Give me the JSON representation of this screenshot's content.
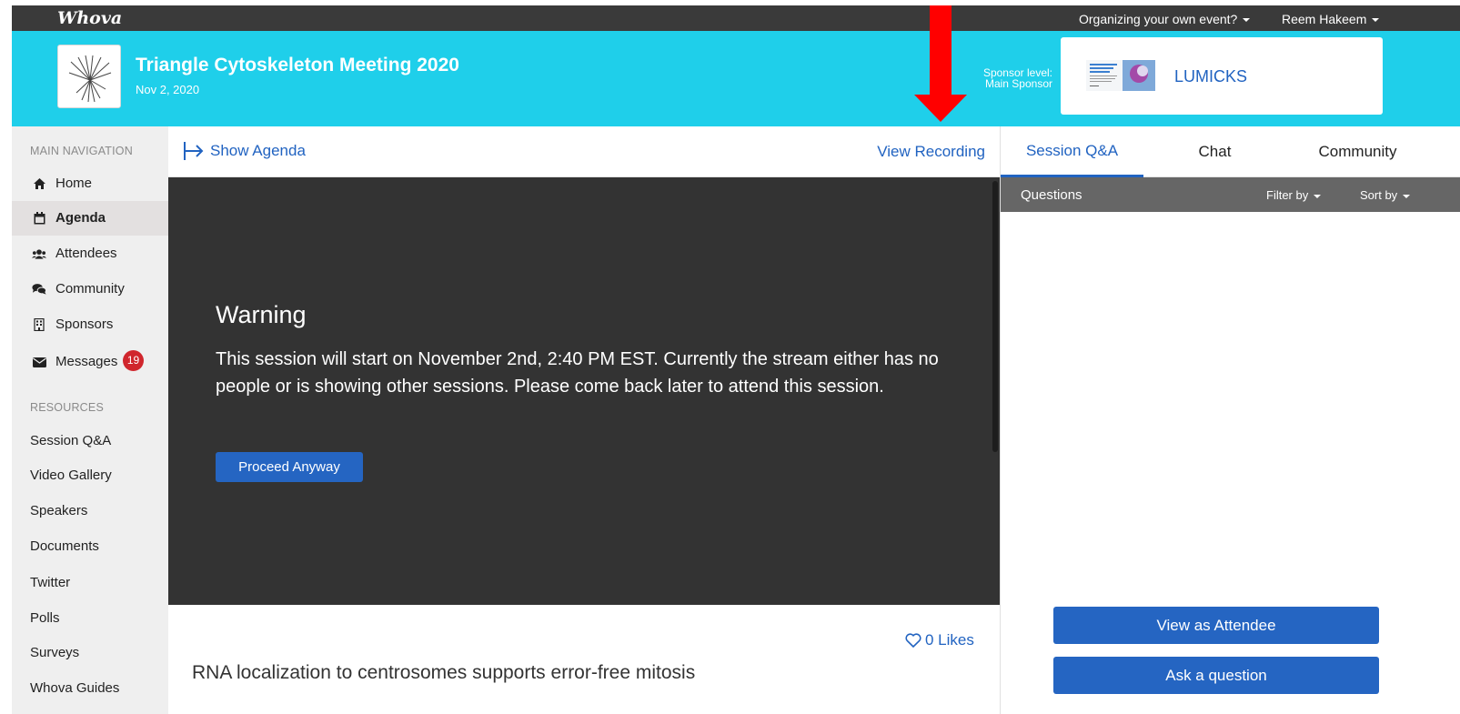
{
  "topbar": {
    "logo": "Whova",
    "organize_menu": "Organizing your own event?",
    "user_menu": "Reem Hakeem"
  },
  "event": {
    "title": "Triangle Cytoskeleton Meeting 2020",
    "date": "Nov 2, 2020",
    "sponsor_label_line1": "Sponsor level:",
    "sponsor_label_line2": "Main Sponsor",
    "sponsor_name": "LUMICKS"
  },
  "sidebar": {
    "main_heading": "MAIN NAVIGATION",
    "items": [
      {
        "label": "Home",
        "icon": "home-icon"
      },
      {
        "label": "Agenda",
        "icon": "calendar-icon",
        "active": true
      },
      {
        "label": "Attendees",
        "icon": "users-icon"
      },
      {
        "label": "Community",
        "icon": "comments-icon"
      },
      {
        "label": "Sponsors",
        "icon": "building-icon"
      },
      {
        "label": "Messages",
        "icon": "envelope-icon",
        "badge": "19"
      }
    ],
    "resources_heading": "RESOURCES",
    "resources": [
      "Session Q&A",
      "Video Gallery",
      "Speakers",
      "Documents",
      "Twitter",
      "Polls",
      "Surveys",
      "Whova Guides"
    ]
  },
  "main": {
    "show_agenda": "Show Agenda",
    "view_recording": "View Recording",
    "warning_title": "Warning",
    "warning_text": "This session will start on November 2nd, 2:40 PM EST. Currently the stream either has no people or is showing other sessions. Please come back later to attend this session.",
    "proceed_button": "Proceed Anyway",
    "likes": "0 Likes",
    "session_title": "RNA localization to centrosomes supports error-free mitosis"
  },
  "panel": {
    "tabs": [
      "Session Q&A",
      "Chat",
      "Community"
    ],
    "active_tab": 0,
    "questions_label": "Questions",
    "filter_by": "Filter by",
    "sort_by": "Sort by",
    "view_as_attendee": "View as Attendee",
    "ask_question": "Ask a question"
  },
  "colors": {
    "header_cyan": "#1fcfea",
    "topbar_dark": "#3a3a3a",
    "link_blue": "#2163c1",
    "button_blue": "#2565c2",
    "video_bg": "#333333",
    "badge_red": "#d0262d",
    "annotation_arrow": "#ff0000"
  }
}
